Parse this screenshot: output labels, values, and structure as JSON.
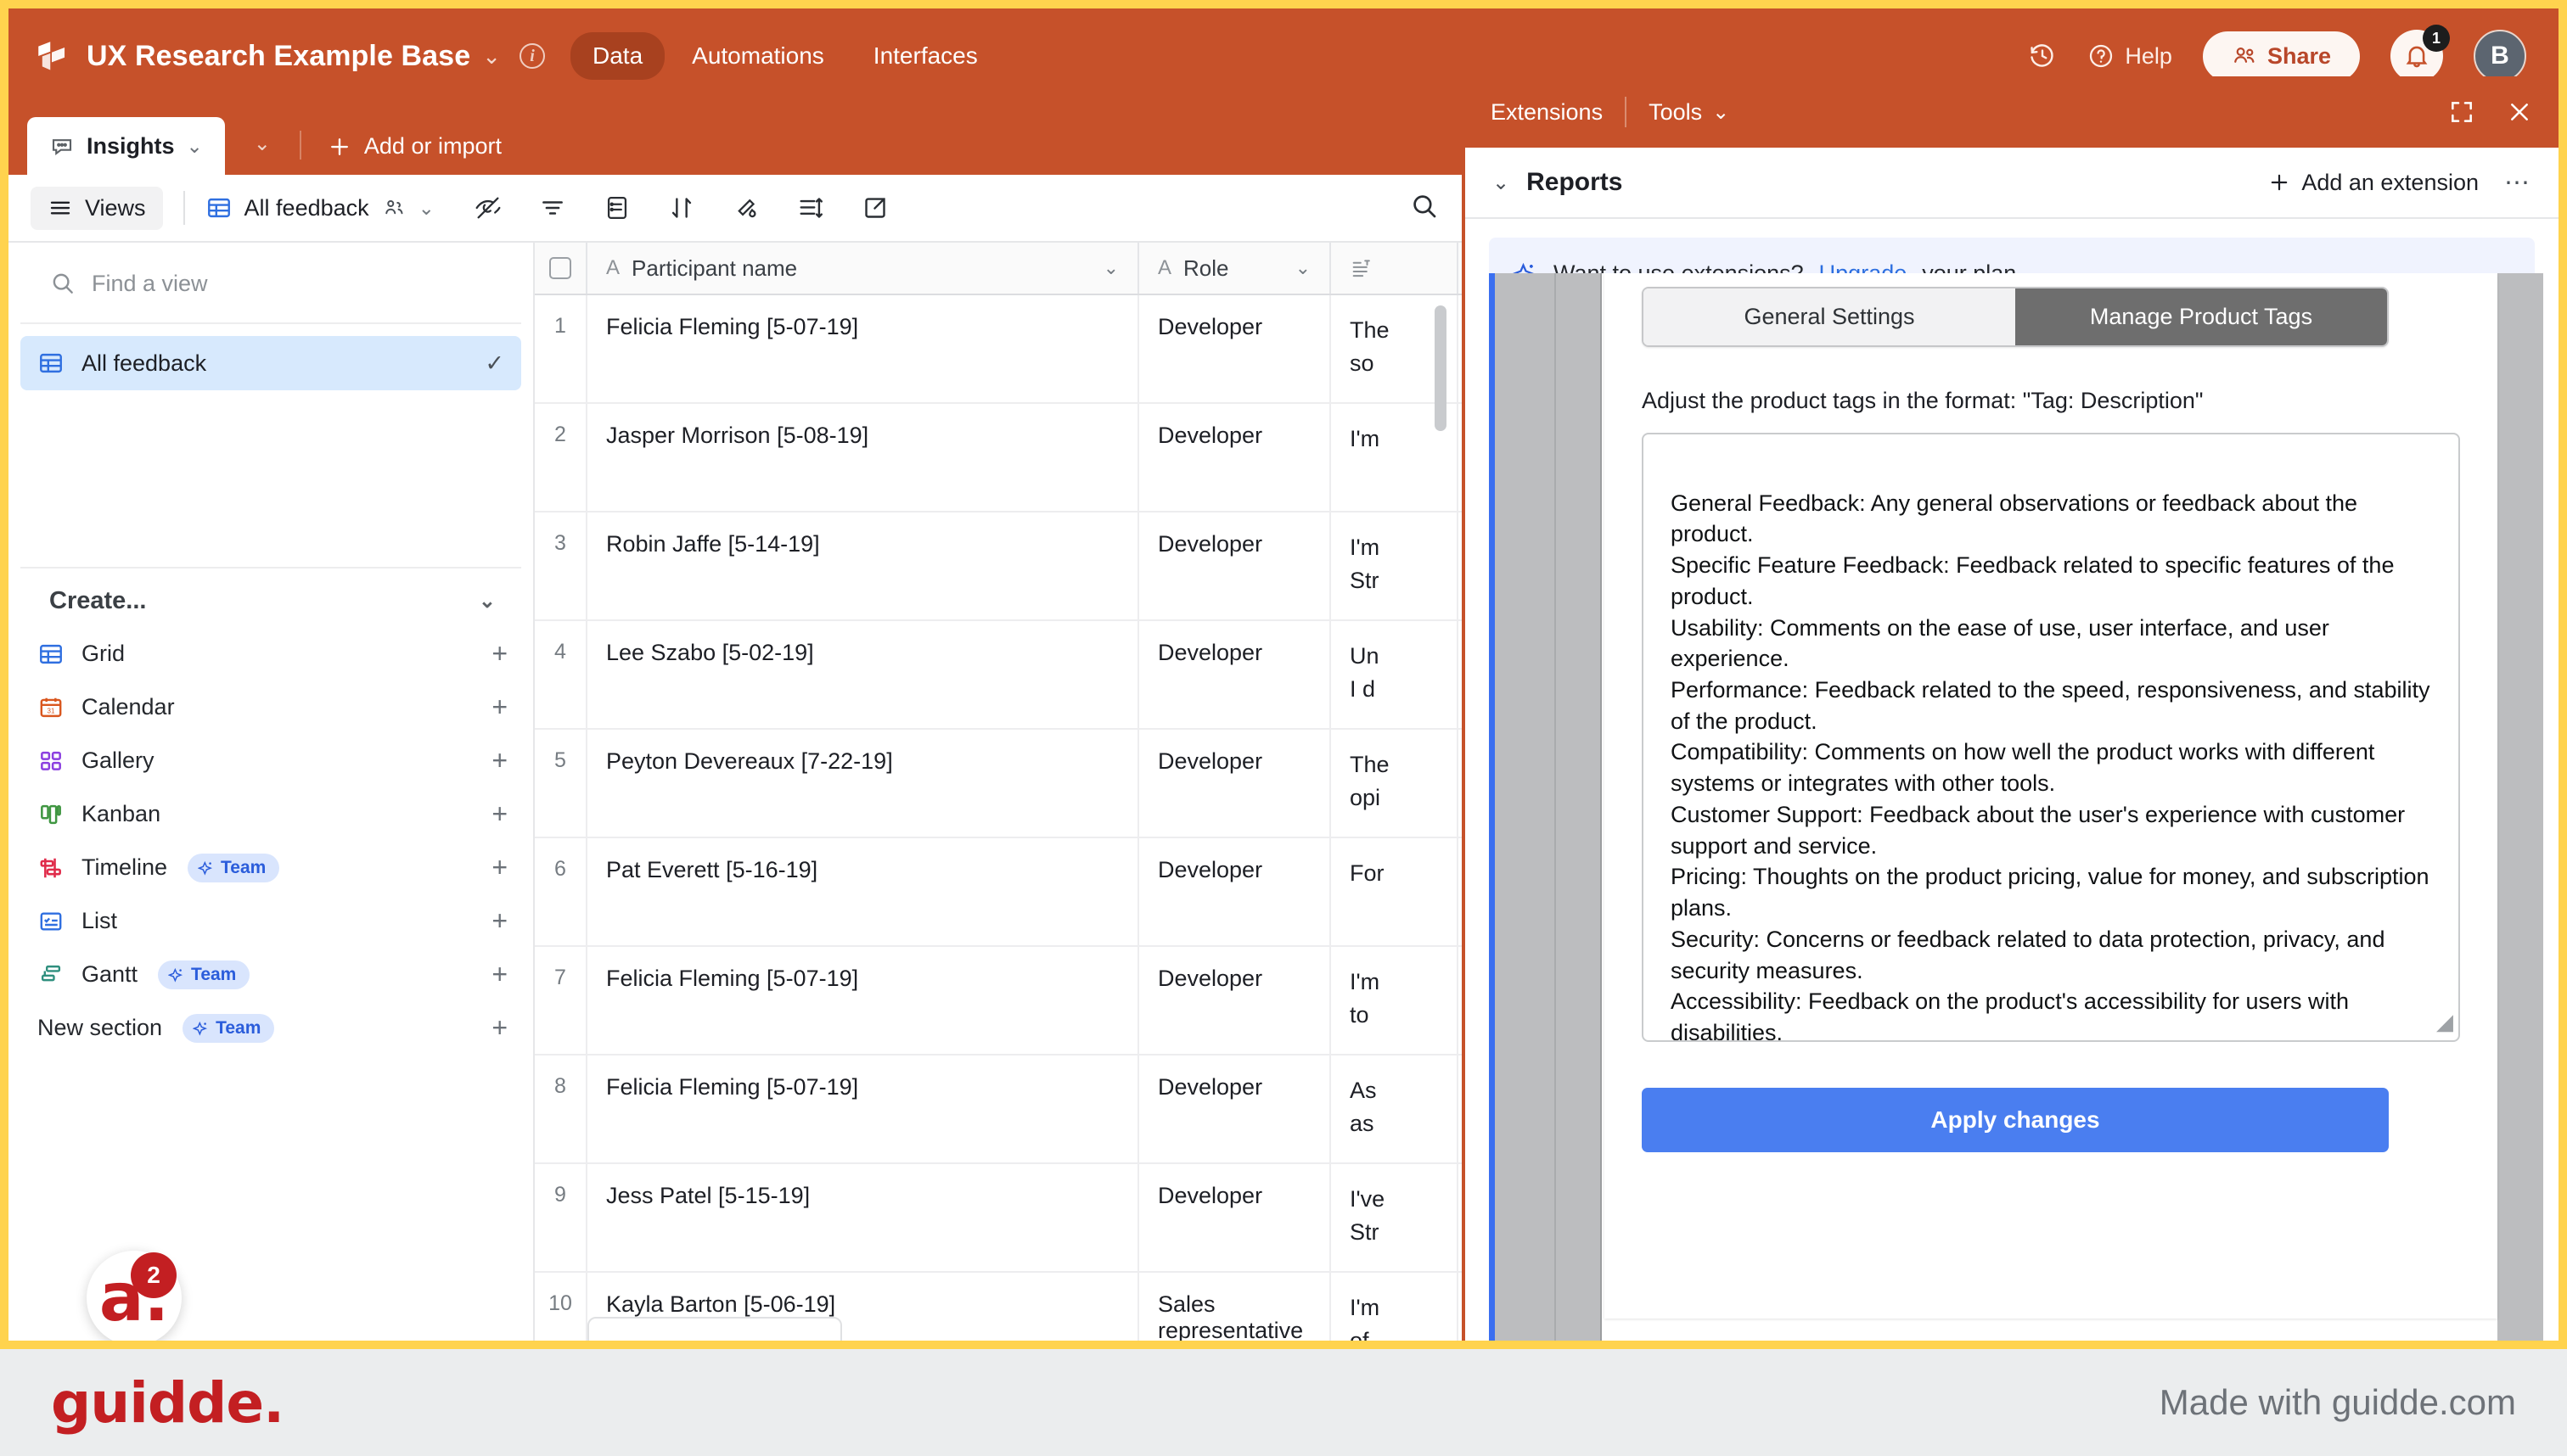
{
  "header": {
    "logo_icon": "airtable-logo-icon",
    "base_title": "UX Research Example Base",
    "caret": "⌄",
    "info_icon": "i",
    "nav": [
      {
        "label": "Data",
        "active": true
      },
      {
        "label": "Automations",
        "active": false
      },
      {
        "label": "Interfaces",
        "active": false
      }
    ],
    "history_icon": "history-icon",
    "help_label": "Help",
    "share_label": "Share",
    "notification_count": "1",
    "avatar_initial": "B"
  },
  "tab_strip": {
    "table_tab": "Insights",
    "table_tab_icon": "speech-bubble-icon",
    "tab_caret": "⌄",
    "strip_caret": "⌄",
    "add_label": "Add or import",
    "add_icon": "plus-icon"
  },
  "grid_toolbar": {
    "views_label": "Views",
    "view_name": "All feedback",
    "icons": [
      "hide-fields-icon",
      "filter-icon",
      "group-icon",
      "sort-icon",
      "color-icon",
      "row-height-icon",
      "share-view-icon"
    ],
    "search_icon": "search-icon"
  },
  "views_sidebar": {
    "find_placeholder": "Find a view",
    "search_icon": "search-icon",
    "views": [
      {
        "label": "All feedback",
        "icon": "grid-icon",
        "selected": true,
        "check": "✓"
      }
    ],
    "create_title": "Create...",
    "create_caret": "⌄",
    "create_items": [
      {
        "label": "Grid",
        "icon": "grid-icon",
        "team": ""
      },
      {
        "label": "Calendar",
        "icon": "calendar-icon",
        "team": ""
      },
      {
        "label": "Gallery",
        "icon": "gallery-icon",
        "team": ""
      },
      {
        "label": "Kanban",
        "icon": "kanban-icon",
        "team": ""
      },
      {
        "label": "Timeline",
        "icon": "timeline-icon",
        "team": "Team"
      },
      {
        "label": "List",
        "icon": "list-icon",
        "team": ""
      },
      {
        "label": "Gantt",
        "icon": "gantt-icon",
        "team": "Team"
      },
      {
        "label": "New section",
        "icon": "section-icon",
        "team": "Team"
      }
    ],
    "guidde_badge": {
      "mark": "a.",
      "count": "2"
    }
  },
  "grid": {
    "columns": [
      {
        "label": "Participant name",
        "type_icon": "A"
      },
      {
        "label": "Role",
        "type_icon": "A"
      },
      {
        "label": "",
        "type_icon": "long-text-icon"
      }
    ],
    "rows": [
      {
        "n": "1",
        "name": "Felicia Fleming [5-07-19]",
        "role": "Developer",
        "fb": "The\nso"
      },
      {
        "n": "2",
        "name": "Jasper Morrison [5-08-19]",
        "role": "Developer",
        "fb": "I'm"
      },
      {
        "n": "3",
        "name": "Robin Jaffe [5-14-19]",
        "role": "Developer",
        "fb": "I'm\nStr"
      },
      {
        "n": "4",
        "name": "Lee Szabo [5-02-19]",
        "role": "Developer",
        "fb": "Un\nI d"
      },
      {
        "n": "5",
        "name": "Peyton Devereaux [7-22-19]",
        "role": "Developer",
        "fb": "The\nopi"
      },
      {
        "n": "6",
        "name": "Pat Everett [5-16-19]",
        "role": "Developer",
        "fb": "For"
      },
      {
        "n": "7",
        "name": "Felicia Fleming [5-07-19]",
        "role": "Developer",
        "fb": "I'm\nto"
      },
      {
        "n": "8",
        "name": "Felicia Fleming [5-07-19]",
        "role": "Developer",
        "fb": "As\nas"
      },
      {
        "n": "9",
        "name": "Jess Patel [5-15-19]",
        "role": "Developer",
        "fb": "I've\nStr"
      },
      {
        "n": "10",
        "name": "Kayla Barton [5-06-19]",
        "role": "Sales representative",
        "fb": "I'm\nof"
      }
    ]
  },
  "ext_panel": {
    "header_items": [
      "Extensions",
      "Tools"
    ],
    "tools_caret": "⌄",
    "expand_icon": "expand-icon",
    "close_icon": "close-icon",
    "section_caret": "⌄",
    "section_title": "Reports",
    "add_extension_label": "Add an extension",
    "add_icon": "plus-icon",
    "more_icon": "⋯",
    "banner": {
      "sparkle_icon": "sparkle-icon",
      "text_before": "Want to use extensions? ",
      "link": "Upgrade",
      "text_after": " your plan."
    },
    "app": {
      "tabs": [
        {
          "label": "General Settings",
          "active": false
        },
        {
          "label": "Manage Product Tags",
          "active": true
        }
      ],
      "hint": "Adjust the product tags in the format: \"Tag: Description\"",
      "textarea_value": "General Feedback: Any general observations or feedback about the product.\nSpecific Feature Feedback: Feedback related to specific features of the product.\nUsability: Comments on the ease of use, user interface, and user experience.\nPerformance: Feedback related to the speed, responsiveness, and stability of the product.\nCompatibility: Comments on how well the product works with different systems or integrates with other tools.\nCustomer Support: Feedback about the user's experience with customer support and service.\nPricing: Thoughts on the product pricing, value for money, and subscription plans.\nSecurity: Concerns or feedback related to data protection, privacy, and security measures.\nAccessibility: Feedback on the product's accessibility for users with disabilities.\nInnovation: Comments on the product's innovation, uniqueness, and new features.",
      "apply_label": "Apply changes"
    }
  },
  "footer": {
    "logo_text": "guidde.",
    "made_with": "Made with guidde.com"
  },
  "colors": {
    "brand_orange": "#c6512a",
    "highlight_yellow": "#ffd34e",
    "accent_blue": "#4a7ef0",
    "guidde_red": "#c31f22"
  }
}
